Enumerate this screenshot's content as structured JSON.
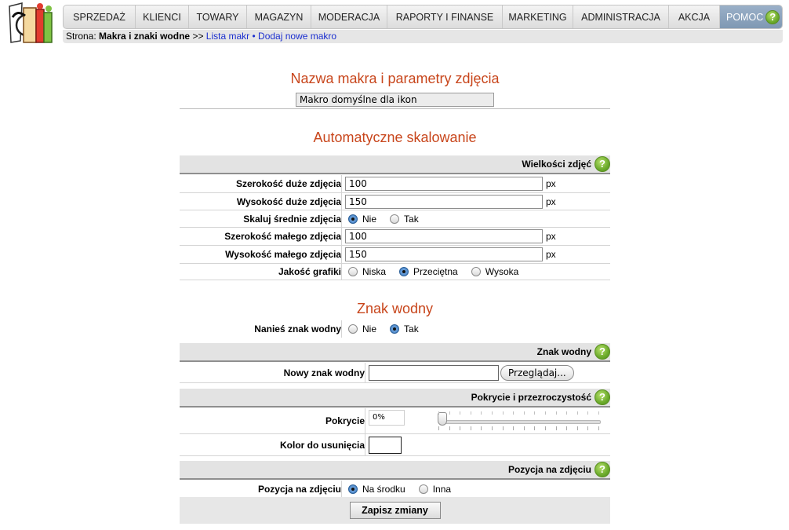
{
  "nav": {
    "items": [
      {
        "label": "SPRZEDAŻ"
      },
      {
        "label": "KLIENCI"
      },
      {
        "label": "TOWARY"
      },
      {
        "label": "MAGAZYN"
      },
      {
        "label": "MODERACJA"
      },
      {
        "label": "RAPORTY I FINANSE"
      },
      {
        "label": "MARKETING"
      },
      {
        "label": "ADMINISTRACJA"
      },
      {
        "label": "AKCJA"
      }
    ],
    "help": "POMOC"
  },
  "breadcrumb": {
    "prefix": "Strona:",
    "current": "Makra i znaki wodne",
    "sep": ">>",
    "link1": "Lista makr",
    "bullet": "•",
    "link2": "Dodaj nowe makro"
  },
  "macro": {
    "title": "Nazwa makra i parametry zdjęcia",
    "name_value": "Makro domyślne dla ikon"
  },
  "scaling": {
    "title": "Automatyczne skalowanie",
    "panel": "Wielkości zdjęć",
    "large_width": {
      "label": "Szerokość duże zdjęcia",
      "value": "100",
      "unit": "px"
    },
    "large_height": {
      "label": "Wysokość duże zdjęcia",
      "value": "150",
      "unit": "px"
    },
    "scale_medium": {
      "label": "Skaluj średnie zdjęcia",
      "options": [
        "Nie",
        "Tak"
      ],
      "selected": "Nie"
    },
    "small_width": {
      "label": "Szerokość małego zdjęcia",
      "value": "100",
      "unit": "px"
    },
    "small_height": {
      "label": "Wysokość małego zdjęcia",
      "value": "150",
      "unit": "px"
    },
    "quality": {
      "label": "Jakość grafiki",
      "options": [
        "Niska",
        "Przeciętna",
        "Wysoka"
      ],
      "selected": "Przeciętna"
    }
  },
  "watermark": {
    "title": "Znak wodny",
    "apply": {
      "label": "Nanieś znak wodny",
      "options": [
        "Nie",
        "Tak"
      ],
      "selected": "Tak"
    },
    "panel": "Znak wodny",
    "new_file": {
      "label": "Nowy znak wodny",
      "button": "Przeglądaj..."
    },
    "coverage_panel": "Pokrycie i przezroczystość",
    "coverage": {
      "label": "Pokrycie",
      "value": "0%",
      "slider_fraction": 0
    },
    "color_remove": {
      "label": "Kolor do usunięcia"
    },
    "position_panel": "Pozycja na zdjęciu",
    "position": {
      "label": "Pozycja na zdjęciu",
      "options": [
        "Na środku",
        "Inna"
      ],
      "selected": "Na środku"
    }
  },
  "save_button": "Zapisz zmiany",
  "colors": {
    "accent_title": "#c8461c",
    "link": "#1b2fcf",
    "help_tab": "#8aa2bd",
    "help_icon": "#6cab2c"
  }
}
